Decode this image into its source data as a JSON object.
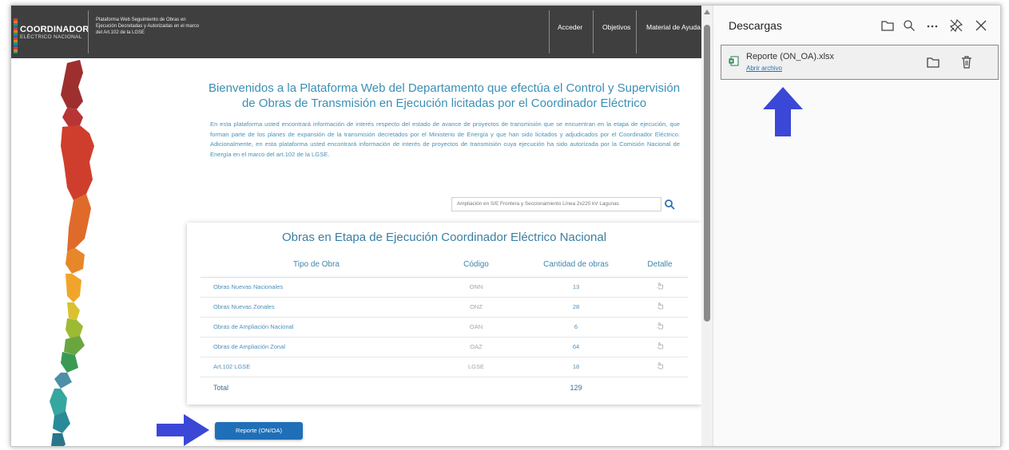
{
  "site": {
    "logo": {
      "main": "COORDINADOR",
      "sub": "ELÉCTRICO NACIONAL"
    },
    "platform_title": "Plataforma Web Seguimiento de Obras en Ejecución Decretadas y Autorizadas en el marco del Art.102 de la LGSE",
    "nav": [
      "Acceder",
      "Objetivos",
      "Material de Ayuda"
    ],
    "welcome_title": "Bienvenidos a la Plataforma Web del Departamento que efectúa el Control y Supervisión de Obras de Transmisión en Ejecución licitadas por el Coordinador Eléctrico",
    "welcome_text": "En esta plataforma usted encontrará información de interés respecto del estado de avance de proyectos de transmisión que se encuentran en la etapa de ejecución, que forman parte de los planes de expansión de la transmisión decretados por el Ministerio de Energía y que han sido licitados y adjudicados por el Coordinador Eléctrico. Adicionalmente, en esta plataforma usted encontrará información de interés de proyectos de transmisión cuya ejecución ha sido autorizada por la Comisión Nacional de Energía en el marco del art.102 de la LGSE.",
    "search_value": "Ampliación en S/E Frontera y Seccionamiento Línea 2x220 kV Lagunas",
    "card": {
      "title": "Obras en Etapa de Ejecución Coordinador Eléctrico Nacional",
      "headers": [
        "Tipo de Obra",
        "Código",
        "Cantidad de obras",
        "Detalle"
      ],
      "rows": [
        {
          "tipo": "Obras Nuevas Nacionales",
          "codigo": "ONN",
          "cantidad": "13"
        },
        {
          "tipo": "Obras Nuevas Zonales",
          "codigo": "ONZ",
          "cantidad": "28"
        },
        {
          "tipo": "Obras de Ampliación Nacional",
          "codigo": "OAN",
          "cantidad": "6"
        },
        {
          "tipo": "Obras de Ampliación Zonal",
          "codigo": "OAZ",
          "cantidad": "64"
        },
        {
          "tipo": "Art.102 LGSE",
          "codigo": "LGSE",
          "cantidad": "18"
        }
      ],
      "total_label": "Total",
      "total_value": "129"
    },
    "report_button": "Reporte (ON/OA)"
  },
  "downloads": {
    "title": "Descargas",
    "icons": [
      "folder-icon",
      "search-icon",
      "more-icon",
      "pin-icon",
      "close-icon"
    ],
    "item": {
      "filename": "Reporte (ON_OA).xlsx",
      "open_link": "Abrir archivo"
    }
  },
  "colors": {
    "accent": "#1f6fb8",
    "arrow": "#3b47d6",
    "header": "#3f3f3f",
    "link_text": "#4d8fbb"
  }
}
